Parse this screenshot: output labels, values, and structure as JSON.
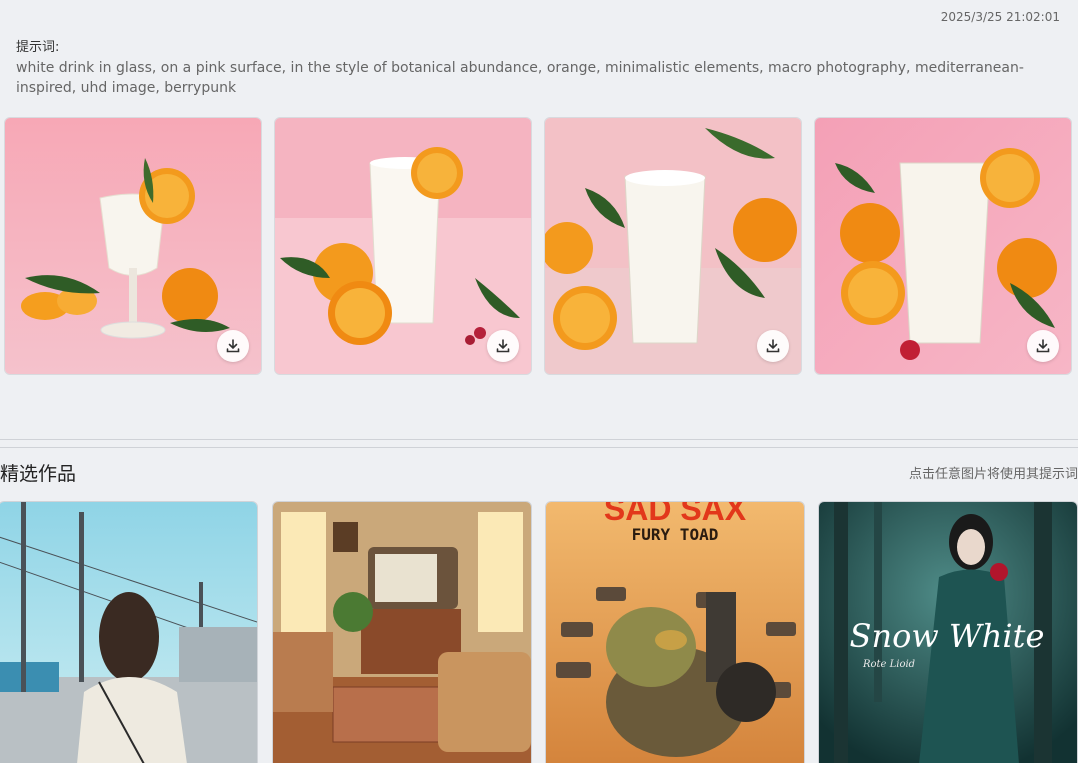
{
  "header": {
    "timestamp": "2025/3/25 21:02:01",
    "prompt_label": "提示词:",
    "prompt_text": "white drink in glass, on a pink surface, in the style of botanical abundance, orange, minimalistic elements, macro photography, mediterranean-inspired, uhd image, berrypunk"
  },
  "generated_images": [
    {
      "name": "generated-image-1",
      "download_icon": "download-icon"
    },
    {
      "name": "generated-image-2",
      "download_icon": "download-icon"
    },
    {
      "name": "generated-image-3",
      "download_icon": "download-icon"
    },
    {
      "name": "generated-image-4",
      "download_icon": "download-icon"
    }
  ],
  "featured": {
    "title": "精选作品",
    "hint": "点击任意图片将使用其提示词",
    "cards": [
      {
        "name": "featured-woman-street"
      },
      {
        "name": "featured-retro-living-room"
      },
      {
        "name": "featured-sad-sax-poster",
        "poster_title": "SAD SAX",
        "poster_subtitle": "FURY TOAD"
      },
      {
        "name": "featured-snow-white-poster",
        "poster_title": "Snow White",
        "poster_subtitle": "Rote Lioid"
      }
    ]
  },
  "colors": {
    "background": "#eef0f3",
    "pink": "#f4b3bf",
    "orange": "#f39a1d",
    "teal": "#1f4a4c"
  }
}
